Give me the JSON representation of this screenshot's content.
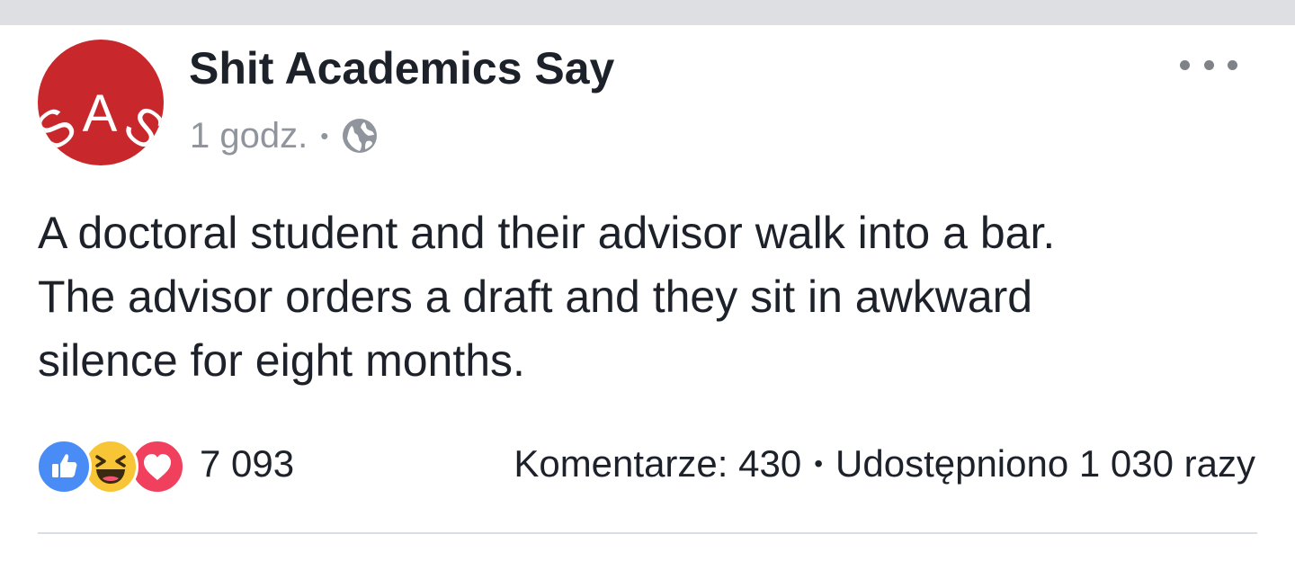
{
  "post": {
    "page_name": "Shit Academics Say",
    "avatar_text": "SAS",
    "timestamp": "1 godz.",
    "separator": "•",
    "privacy_icon": "globe-icon",
    "more_icon": "more-horizontal-icon",
    "text_lines": [
      "A doctoral student and their advisor walk into a bar.",
      "The advisor orders a draft and they sit in awkward",
      "silence for eight months."
    ]
  },
  "reactions": {
    "icons": [
      "like-icon",
      "haha-icon",
      "love-icon"
    ],
    "count": "7 093"
  },
  "stats": {
    "comments": "Komentarze: 430",
    "separator": "•",
    "shares": "Udostępniono 1 030 razy"
  },
  "colors": {
    "avatar_red": "#c8282c",
    "like_blue": "#4a8cf5",
    "haha_yellow": "#f7c535",
    "love_red": "#f0405e",
    "text_dark": "#1d2129",
    "meta_gray": "#90949c"
  }
}
